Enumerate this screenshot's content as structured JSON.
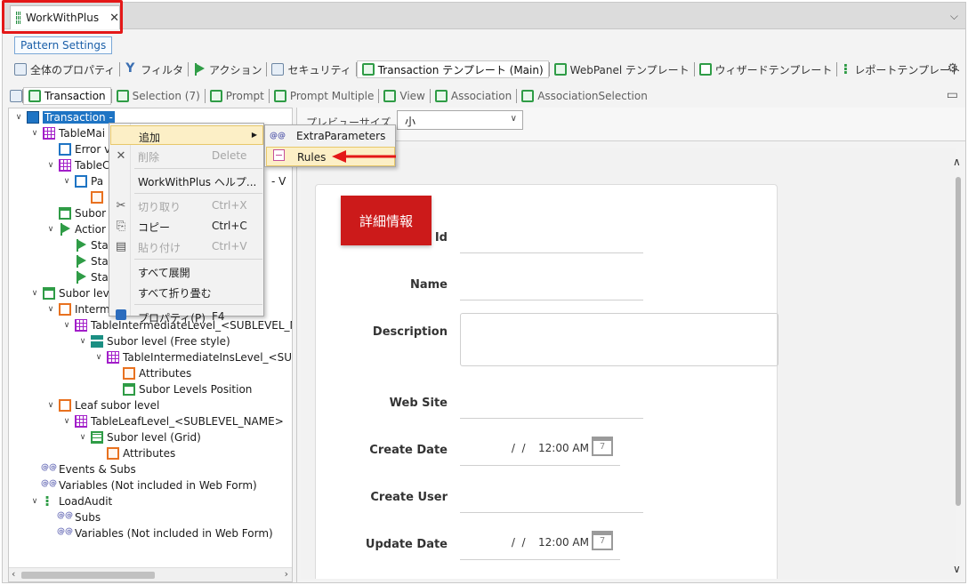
{
  "window": {
    "tab_title": "WorkWithPlus",
    "close_glyph": "✕",
    "collapse_glyph": "⌵"
  },
  "pattern_settings_label": "Pattern Settings",
  "toolbar1": [
    {
      "label": "全体のプロパティ",
      "icon": "properties-icon"
    },
    {
      "label": "フィルタ",
      "icon": "filter-icon"
    },
    {
      "label": "アクション",
      "icon": "flag-icon"
    },
    {
      "label": "セキュリティ",
      "icon": "security-icon"
    },
    {
      "label": "Transaction テンプレート (Main)",
      "icon": "transaction-icon",
      "active": true
    },
    {
      "label": "WebPanel テンプレート",
      "icon": "webpanel-icon"
    },
    {
      "label": "ウィザードテンプレート",
      "icon": "wizard-icon"
    },
    {
      "label": "レポートテンプレート",
      "icon": "report-icon"
    }
  ],
  "toolbar2": [
    {
      "label": "Transaction",
      "active": true
    },
    {
      "label": "Selection (7)"
    },
    {
      "label": "Prompt"
    },
    {
      "label": "Prompt Multiple"
    },
    {
      "label": "View"
    },
    {
      "label": "Association"
    },
    {
      "label": "AssociationSelection"
    }
  ],
  "tree": [
    {
      "label": "Transaction -",
      "indent": 0,
      "toggle": "∨",
      "icon": "transaction",
      "selected": true
    },
    {
      "label": "TableMai",
      "indent": 1,
      "toggle": "∨",
      "icon": "table"
    },
    {
      "label": "Error v",
      "indent": 2,
      "toggle": "",
      "icon": "err"
    },
    {
      "label": "TableC",
      "indent": 2,
      "toggle": "∨",
      "icon": "table"
    },
    {
      "label": "Pa",
      "indent": 3,
      "toggle": "∨",
      "icon": "err"
    },
    {
      "label": "",
      "indent": 4,
      "toggle": "",
      "icon": "attr"
    },
    {
      "label": "Subor",
      "indent": 2,
      "toggle": "",
      "icon": "panel"
    },
    {
      "label": "Actior",
      "indent": 2,
      "toggle": "∨",
      "icon": "flag"
    },
    {
      "label": "Sta",
      "indent": 3,
      "toggle": "",
      "icon": "flag"
    },
    {
      "label": "Sta",
      "indent": 3,
      "toggle": "",
      "icon": "flag"
    },
    {
      "label": "Sta",
      "indent": 3,
      "toggle": "",
      "icon": "flag"
    },
    {
      "label": "Subor lev",
      "indent": 1,
      "toggle": "∨",
      "icon": "panel"
    },
    {
      "label": "Interm",
      "indent": 2,
      "toggle": "∨",
      "icon": "orange"
    },
    {
      "label": "TableIntermediateLevel_<SUBLEVEL_NA",
      "indent": 3,
      "toggle": "∨",
      "icon": "table"
    },
    {
      "label": "Subor level (Free style)",
      "indent": 4,
      "toggle": "∨",
      "icon": "free"
    },
    {
      "label": "TableIntermediateInsLevel_<SUBL",
      "indent": 5,
      "toggle": "∨",
      "icon": "table"
    },
    {
      "label": "Attributes",
      "indent": 6,
      "toggle": "",
      "icon": "attr"
    },
    {
      "label": "Subor Levels Position",
      "indent": 6,
      "toggle": "",
      "icon": "panel"
    },
    {
      "label": "Leaf subor level",
      "indent": 2,
      "toggle": "∨",
      "icon": "orange"
    },
    {
      "label": "TableLeafLevel_<SUBLEVEL_NAME>",
      "indent": 3,
      "toggle": "∨",
      "icon": "table"
    },
    {
      "label": "Subor level (Grid)",
      "indent": 4,
      "toggle": "∨",
      "icon": "grid"
    },
    {
      "label": "Attributes",
      "indent": 5,
      "toggle": "",
      "icon": "attr"
    },
    {
      "label": "Events & Subs",
      "indent": 1,
      "toggle": "",
      "icon": "events"
    },
    {
      "label": "Variables (Not included in Web Form)",
      "indent": 1,
      "toggle": "",
      "icon": "events"
    },
    {
      "label": "LoadAudit",
      "indent": 1,
      "toggle": "∨",
      "icon": "loadaudit"
    },
    {
      "label": "Subs",
      "indent": 2,
      "toggle": "",
      "icon": "events"
    },
    {
      "label": "Variables (Not included in Web Form)",
      "indent": 2,
      "toggle": "",
      "icon": "events"
    }
  ],
  "tree_extra": {
    "dash_v": "- V"
  },
  "preview": {
    "label": "プレビューサイズ",
    "selected": "小"
  },
  "form": {
    "title": "詳細情報",
    "fields": [
      {
        "label": "Id",
        "type": "line"
      },
      {
        "label": "Name",
        "type": "line"
      },
      {
        "label": "Description",
        "type": "textarea"
      },
      {
        "label": "Web Site",
        "type": "line"
      },
      {
        "label": "Create Date",
        "type": "datetime",
        "date": " /  /",
        "time": "12:00 AM"
      },
      {
        "label": "Create User",
        "type": "line"
      },
      {
        "label": "Update Date",
        "type": "datetime",
        "date": " /  /",
        "time": "12:00 AM"
      }
    ],
    "calendar_glyph": "7"
  },
  "context_menu": {
    "items": [
      {
        "label": "追加",
        "shortcut": "",
        "icon": "",
        "highlighted": true,
        "submenu": true
      },
      {
        "label": "削除",
        "shortcut": "Delete",
        "icon": "✕",
        "disabled": true
      },
      {
        "sep": true
      },
      {
        "label": "WorkWithPlus ヘルプ...",
        "shortcut": "",
        "icon": ""
      },
      {
        "sep": true
      },
      {
        "label": "切り取り",
        "shortcut": "Ctrl+X",
        "icon": "✂",
        "disabled": true
      },
      {
        "label": "コピー",
        "shortcut": "Ctrl+C",
        "icon": "⎘"
      },
      {
        "label": "貼り付け",
        "shortcut": "Ctrl+V",
        "icon": "▤",
        "disabled": true
      },
      {
        "sep": true
      },
      {
        "label": "すべて展開",
        "shortcut": "",
        "icon": ""
      },
      {
        "label": "すべて折り畳む",
        "shortcut": "",
        "icon": ""
      },
      {
        "sep": true
      },
      {
        "label": "プロパティ(P)",
        "shortcut": "F4",
        "icon": "prop"
      }
    ]
  },
  "submenu": {
    "items": [
      {
        "label": "ExtraParameters",
        "icon": "@@"
      },
      {
        "label": "Rules",
        "icon": "rules",
        "highlighted": true
      }
    ]
  },
  "colors": {
    "highlight_red": "#e41818",
    "title_badge": "#cc1a1a",
    "selection_blue": "#1e74c4",
    "menu_hover": "#fcefc6"
  }
}
